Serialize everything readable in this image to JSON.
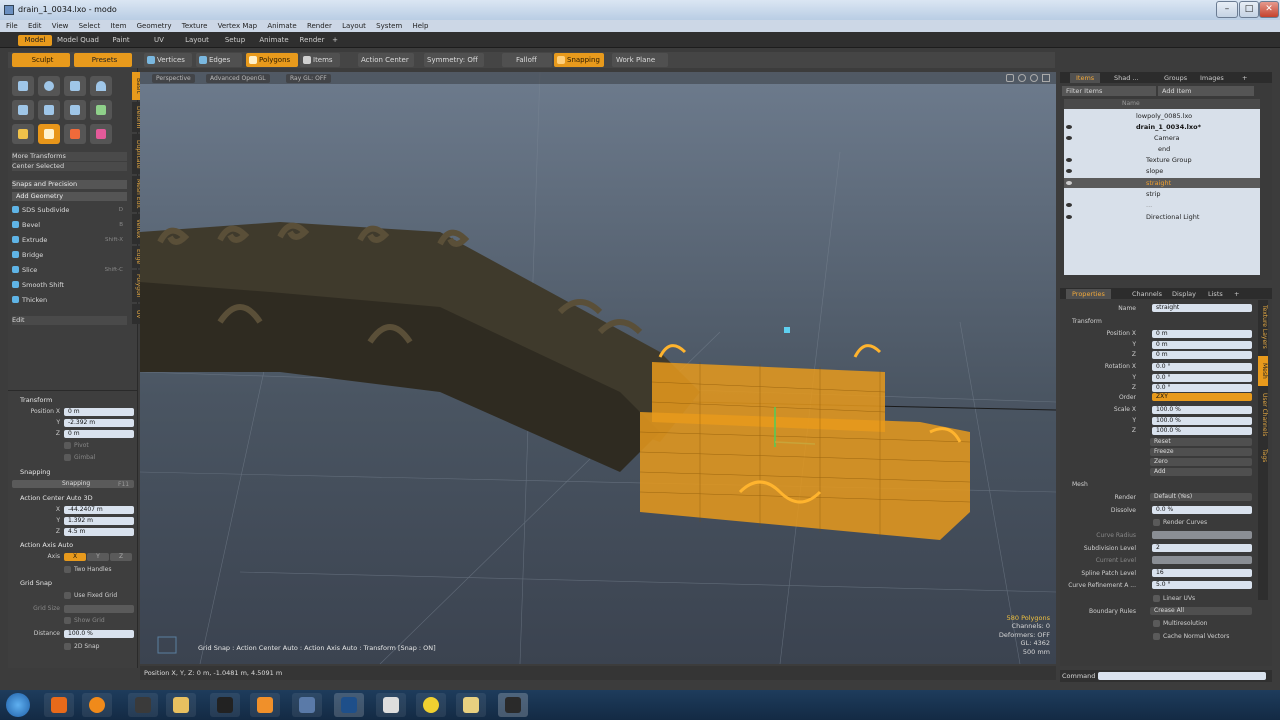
{
  "window": {
    "title": "drain_1_0034.lxo - modo",
    "controls": [
      "–",
      "□",
      "✕"
    ]
  },
  "menu": [
    "File",
    "Edit",
    "View",
    "Select",
    "Item",
    "Geometry",
    "Texture",
    "Vertex Map",
    "Animate",
    "Render",
    "Layout",
    "System",
    "Help"
  ],
  "modes": [
    "Model",
    "Model Quad",
    "Paint",
    "UV",
    "Layout",
    "Setup",
    "Animate",
    "Render",
    "+"
  ],
  "left_tabs": {
    "sculpt": "Sculpt",
    "presets": "Presets"
  },
  "left_side_tabs": [
    "Basic",
    "Deform",
    "Duplicate",
    "Mesh Edit",
    "Vertex",
    "Edge",
    "Polygon",
    "UV"
  ],
  "left_menus": {
    "more_transforms": "More Transforms",
    "center_selected": "Center Selected",
    "snaps": "Snaps and Precision",
    "add_geometry": "Add Geometry",
    "edit": "Edit"
  },
  "tools": [
    {
      "label": "SDS Subdivide",
      "key": "D"
    },
    {
      "label": "Bevel",
      "key": "B"
    },
    {
      "label": "Extrude",
      "key": "Shift-X"
    },
    {
      "label": "Bridge",
      "key": ""
    },
    {
      "label": "Slice",
      "key": "Shift-C"
    },
    {
      "label": "Smooth Shift",
      "key": ""
    },
    {
      "label": "Thicken",
      "key": ""
    }
  ],
  "tool_props": {
    "transform": "Transform",
    "pos_x_label": "Position X",
    "pos_x": "0 m",
    "y_label": "Y",
    "pos_y": "-2.392 m",
    "z_label": "Z",
    "pos_z": "0 m",
    "pivot": "Pivot",
    "gimbal": "Gimbal",
    "snapping_head": "Snapping",
    "snapping_btn": "Snapping",
    "snapping_key": "F11",
    "action_center": "Action Center Auto 3D",
    "ac_x": "-44.2407 m",
    "ac_y": "1.392 m",
    "ac_z": "4.5 m",
    "action_axis": "Action Axis Auto",
    "axis_label": "Axis",
    "axis_x": "X",
    "axis_y": "Y",
    "axis_z": "Z",
    "two_handles": "Two Handles",
    "grid_snap": "Grid Snap",
    "use_fixed_grid": "Use Fixed Grid",
    "grid_size": "Grid Size",
    "show_grid": "Show Grid",
    "distance_label": "Distance",
    "distance": "100.0 %",
    "snap2d": "2D Snap"
  },
  "toolbar": {
    "vertices": "Vertices",
    "edges": "Edges",
    "polygons": "Polygons",
    "items": "Items",
    "action_center": "Action Center",
    "symmetry": "Symmetry: Off",
    "falloff": "Falloff",
    "snapping": "Snapping",
    "work_plane": "Work Plane"
  },
  "viewport": {
    "tabs": [
      "Perspective",
      "Advanced OpenGL",
      "Ray GL: OFF"
    ],
    "stats": [
      "580 Polygons",
      "Channels: 0",
      "Deformers: OFF",
      "GL: 4362",
      "500 mm"
    ],
    "status": "Grid Snap : Action Center Auto : Action Axis Auto : Transform  [Snap : ON]"
  },
  "statusbar": {
    "position": "Position X, Y, Z:  0 m, -1.0481 m, 4.5091 m"
  },
  "items_panel": {
    "tabs": [
      "Items",
      "Shad ...",
      "Groups",
      "Images",
      "+"
    ],
    "filter": "Filter Items",
    "add_item": "Add Item",
    "name_col": "Name",
    "rows": [
      {
        "label": "lowpoly_0085.lxo"
      },
      {
        "label": "drain_1_0034.lxo*"
      },
      {
        "label": "Camera"
      },
      {
        "label": "end"
      },
      {
        "label": "Texture Group"
      },
      {
        "label": "slope"
      },
      {
        "label": "straight"
      },
      {
        "label": "strip"
      },
      {
        "label": "..."
      },
      {
        "label": "Directional Light"
      }
    ]
  },
  "props_panel": {
    "tabs": [
      "Properties",
      "Channels",
      "Display",
      "Lists",
      "+"
    ],
    "side_tabs": [
      "Texture Layers",
      "Mesh",
      "User Channels",
      "Tags"
    ],
    "name_label": "Name",
    "name": "straight",
    "transform": "Transform",
    "pos_label": "Position X",
    "pos": [
      "0 m",
      "0 m",
      "0 m"
    ],
    "rot_label": "Rotation X",
    "rot": [
      "0.0 °",
      "0.0 °",
      "0.0 °"
    ],
    "order_label": "Order",
    "order": "ZXY",
    "scale_label": "Scale X",
    "scale": [
      "100.0 %",
      "100.0 %",
      "100.0 %"
    ],
    "y": "Y",
    "z": "Z",
    "buttons": [
      "Reset",
      "Freeze",
      "Zero",
      "Add"
    ],
    "mesh": "Mesh",
    "render_label": "Render",
    "render": "Default (Yes)",
    "dissolve_label": "Dissolve",
    "dissolve": "0.0 %",
    "render_curves": "Render Curves",
    "curve_radius": "Curve Radius",
    "subdiv_label": "Subdivision Level",
    "subdiv": "2",
    "current_level": "Current Level",
    "spline_label": "Spline Patch Level",
    "spline": "16",
    "curve_ref_label": "Curve Refinement A ...",
    "curve_ref": "5.0 °",
    "linear_uvs": "Linear UVs",
    "boundary_label": "Boundary Rules",
    "boundary": "Crease All",
    "multires": "Multiresolution",
    "cache_normals": "Cache Normal Vectors"
  },
  "command": {
    "label": "Command"
  },
  "colors": {
    "accent": "#e89a1c",
    "panel": "#3a3a3a",
    "field": "#d9e2ee"
  }
}
